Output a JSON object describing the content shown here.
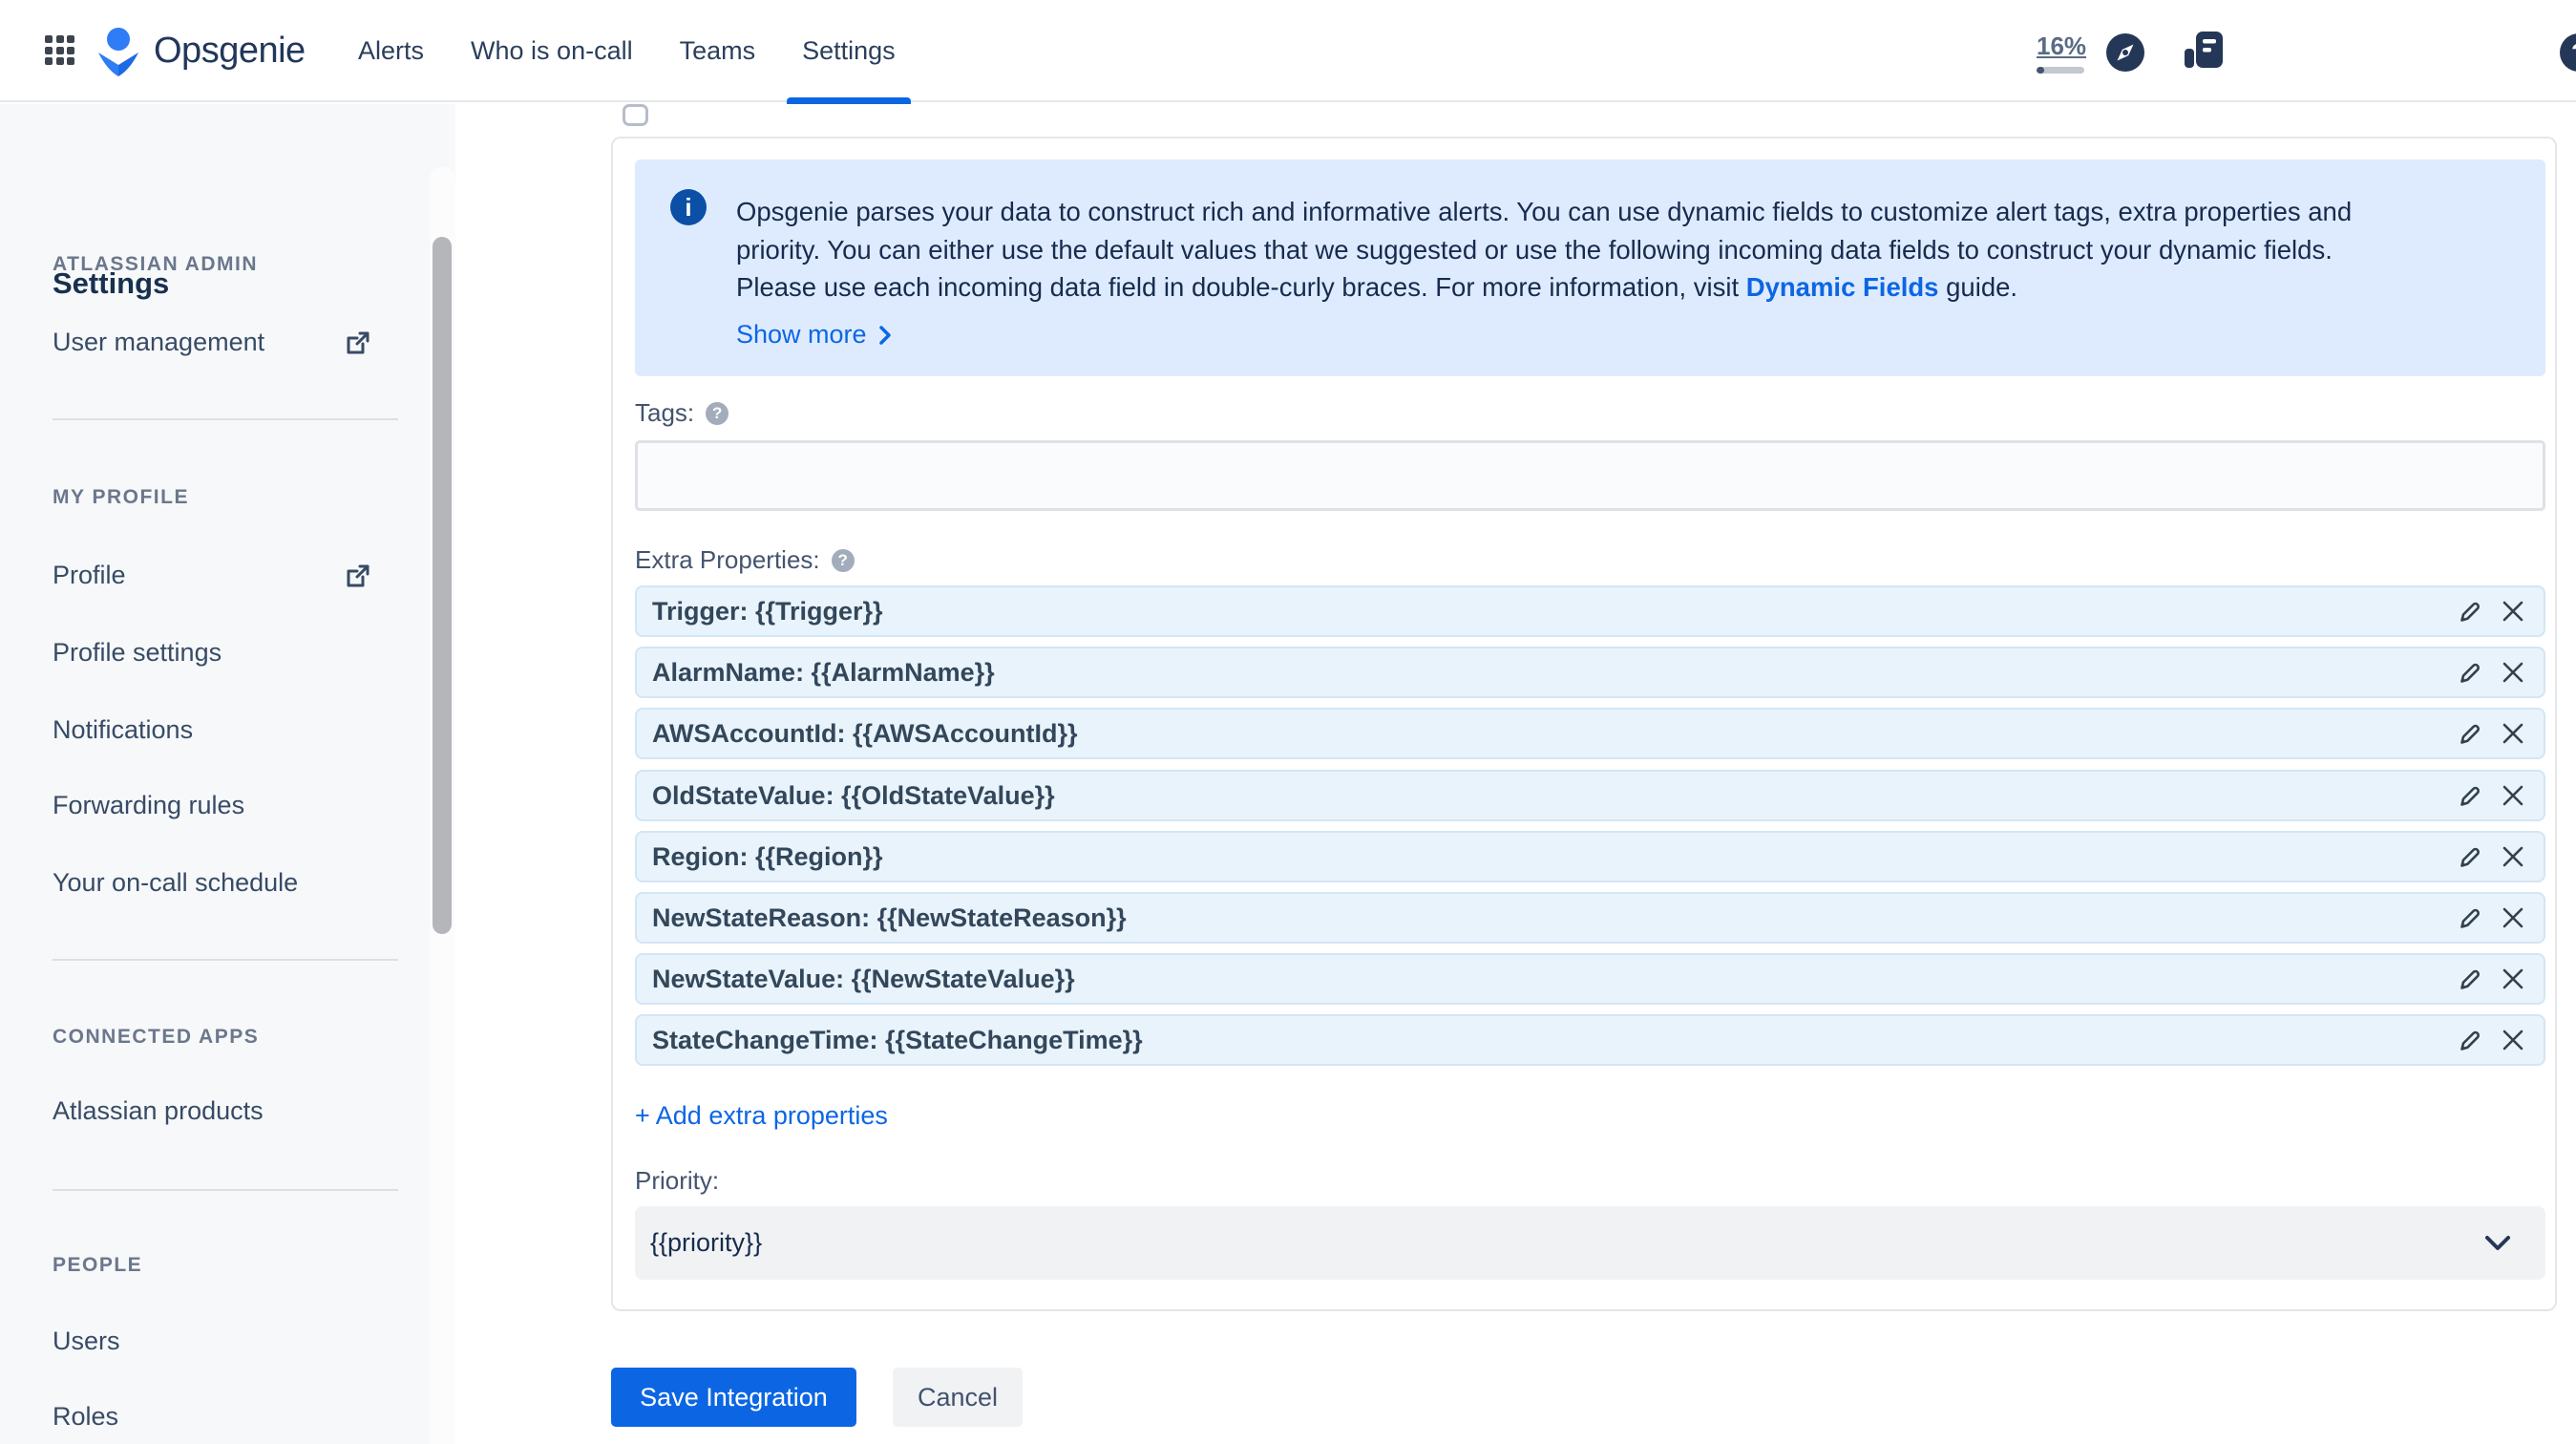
{
  "navbar": {
    "brand": "Opsgenie",
    "nav_items": [
      {
        "label": "Alerts"
      },
      {
        "label": "Who is on-call"
      },
      {
        "label": "Teams"
      },
      {
        "label": "Settings"
      }
    ],
    "trial_percent": "16%",
    "help_glyph": "?"
  },
  "sidebar": {
    "title": "Settings",
    "sections": [
      {
        "label": "ATLASSIAN ADMIN",
        "items": [
          {
            "label": "User management"
          }
        ]
      },
      {
        "label": "MY PROFILE",
        "items": [
          {
            "label": "Profile"
          },
          {
            "label": "Profile settings"
          },
          {
            "label": "Notifications"
          },
          {
            "label": "Forwarding rules"
          },
          {
            "label": "Your on-call schedule"
          }
        ]
      },
      {
        "label": "CONNECTED APPS",
        "items": [
          {
            "label": "Atlassian products"
          }
        ]
      },
      {
        "label": "PEOPLE",
        "items": [
          {
            "label": "Users"
          },
          {
            "label": "Roles"
          }
        ]
      }
    ]
  },
  "main": {
    "info_banner": {
      "icon_glyph": "i",
      "line1": "Opsgenie parses your data to construct rich and informative alerts. You can use dynamic fields to customize alert tags, extra properties and",
      "line2": "priority. You can either use the default values that we suggested or use the following incoming data fields to construct your dynamic fields.",
      "line3_before": "Please use each incoming data field in double-curly braces. For more information, visit ",
      "link_text": "Dynamic Fields",
      "line3_after": " guide.",
      "show_more": "Show more"
    },
    "tags": {
      "label": "Tags:",
      "value": "",
      "help_glyph": "?"
    },
    "extra_properties": {
      "label": "Extra Properties:",
      "help_glyph": "?",
      "rows": [
        "Trigger: {{Trigger}}",
        "AlarmName: {{AlarmName}}",
        "AWSAccountId: {{AWSAccountId}}",
        "OldStateValue: {{OldStateValue}}",
        "Region: {{Region}}",
        "NewStateReason: {{NewStateReason}}",
        "NewStateValue: {{NewStateValue}}",
        "StateChangeTime: {{StateChangeTime}}"
      ],
      "add_label": "+ Add extra properties"
    },
    "priority": {
      "label": "Priority:",
      "value": "{{priority}}"
    },
    "buttons": {
      "save": "Save Integration",
      "cancel": "Cancel"
    }
  },
  "colors": {
    "accent": "#0C66E4",
    "banner_bg": "#DEEBFF",
    "row_bg": "#E9F3FB",
    "nav_dark": "#243757",
    "logo_blue": "#2E7CF6"
  }
}
